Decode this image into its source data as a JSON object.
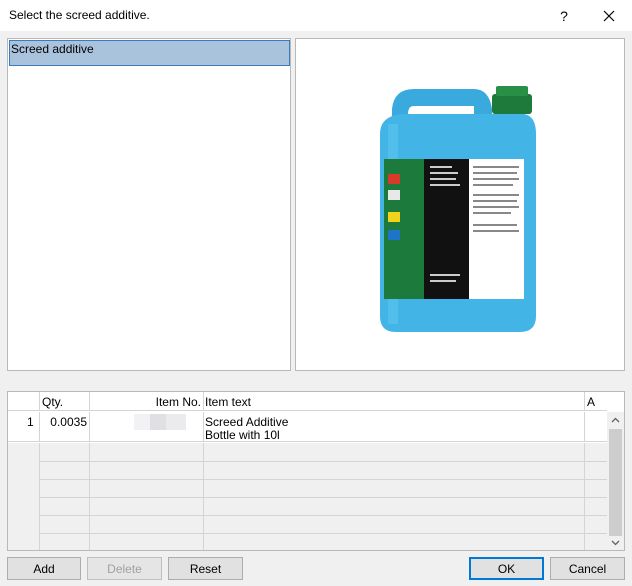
{
  "window": {
    "title": "Select the screed additive."
  },
  "titlebar": {
    "help_label": "?"
  },
  "list": {
    "items": [
      {
        "label": "Screed additive",
        "selected": true
      }
    ]
  },
  "preview": {
    "icon": "product-canister-image",
    "accent_color": "#42b4e6"
  },
  "grid": {
    "columns": [
      "",
      "Qty.",
      "Item No.",
      "Item text",
      "A"
    ],
    "rows": [
      {
        "index": "1",
        "qty": "0.0035",
        "item_no": "",
        "text_line1": "Screed Additive",
        "text_line2": "Bottle with 10l",
        "a": ""
      }
    ]
  },
  "buttons": {
    "add": "Add",
    "delete": "Delete",
    "reset": "Reset",
    "ok": "OK",
    "cancel": "Cancel"
  }
}
